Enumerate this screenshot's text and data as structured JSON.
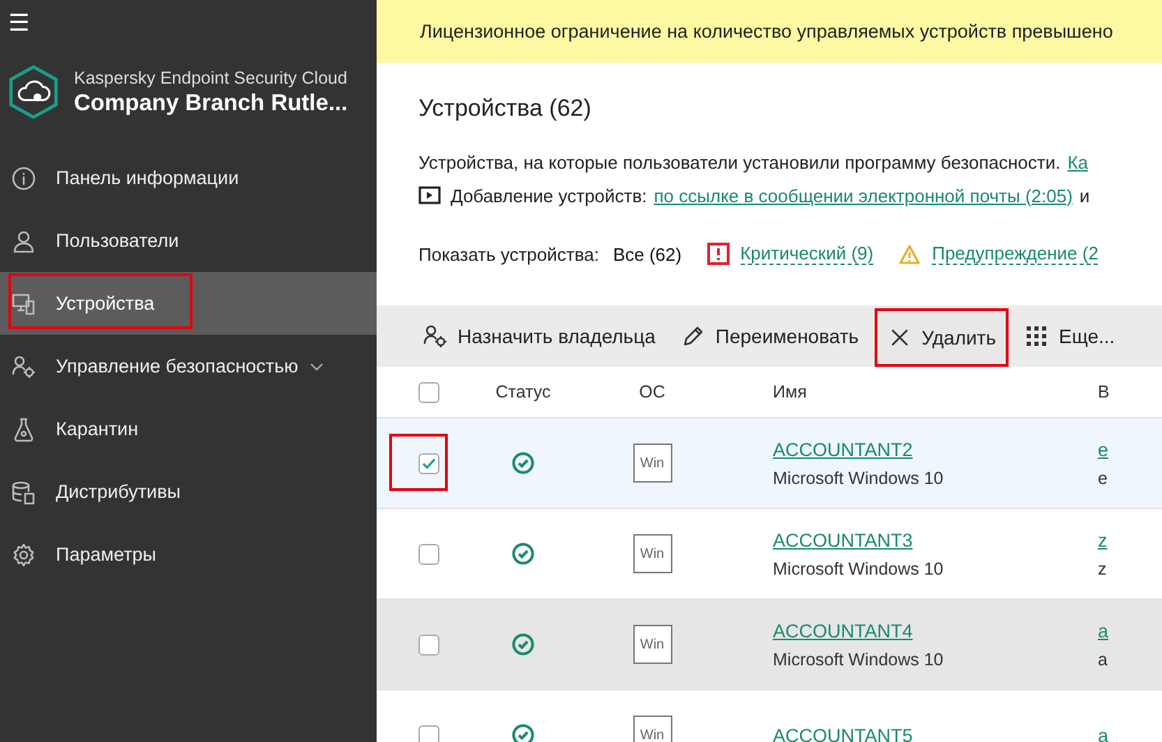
{
  "sidebar": {
    "menu_icon": "☰",
    "app_name": "Kaspersky Endpoint Security Cloud",
    "company": "Company Branch Rutle...",
    "items": [
      {
        "label": "Панель информации",
        "kind": "info",
        "selected": false,
        "highlighted": false,
        "expandable": false
      },
      {
        "label": "Пользователи",
        "kind": "user",
        "selected": false,
        "highlighted": false,
        "expandable": false
      },
      {
        "label": "Устройства",
        "kind": "devices",
        "selected": true,
        "highlighted": true,
        "expandable": false
      },
      {
        "label": "Управление безопасностью",
        "kind": "security",
        "selected": false,
        "highlighted": false,
        "expandable": true
      },
      {
        "label": "Карантин",
        "kind": "quarantine",
        "selected": false,
        "highlighted": false,
        "expandable": false
      },
      {
        "label": "Дистрибутивы",
        "kind": "packages",
        "selected": false,
        "highlighted": false,
        "expandable": false
      },
      {
        "label": "Параметры",
        "kind": "settings",
        "selected": false,
        "highlighted": false,
        "expandable": false
      }
    ]
  },
  "banner": {
    "text": "Лицензионное ограничение на количество управляемых устройств превышено"
  },
  "page": {
    "title": "Устройства (62)",
    "description": "Устройства, на которые пользователи установили программу безопасности.",
    "description_link": "Ка",
    "video_label": "Добавление устройств:",
    "video_link": "по ссылке в сообщении электронной почты (2:05)",
    "video_tail": "и"
  },
  "filter": {
    "label": "Показать устройства:",
    "options": [
      {
        "label": "Все (62)",
        "kind": "all",
        "selected": true
      },
      {
        "label": "Критический (9)",
        "kind": "critical",
        "selected": false
      },
      {
        "label": "Предупреждение (2",
        "kind": "warning",
        "selected": false
      }
    ]
  },
  "toolbar": [
    {
      "label": "Назначить владельца",
      "kind": "owner",
      "highlighted": false
    },
    {
      "label": "Переименовать",
      "kind": "rename",
      "highlighted": false
    },
    {
      "label": "Удалить",
      "kind": "delete",
      "highlighted": true
    },
    {
      "label": "Еще...",
      "kind": "more",
      "highlighted": false
    }
  ],
  "table": {
    "select_all": {
      "checked": false
    },
    "columns": [
      {
        "label": "Статус"
      },
      {
        "label": "ОС"
      },
      {
        "label": "Имя"
      },
      {
        "label": "В"
      }
    ],
    "rows": [
      {
        "selected": true,
        "highlighted": true,
        "hovered": false,
        "kind": "ok",
        "os": "Win",
        "name": "ACCOUNTANT2",
        "os_name": "Microsoft Windows 10",
        "column_5": "e",
        "column_5_sub": "e"
      },
      {
        "selected": false,
        "highlighted": false,
        "hovered": false,
        "kind": "ok",
        "os": "Win",
        "name": "ACCOUNTANT3",
        "os_name": "Microsoft Windows 10",
        "column_5": "z",
        "column_5_sub": "z"
      },
      {
        "selected": false,
        "highlighted": false,
        "hovered": true,
        "kind": "ok",
        "os": "Win",
        "name": "ACCOUNTANT4",
        "os_name": "Microsoft Windows 10",
        "column_5": "a",
        "column_5_sub": "a"
      },
      {
        "selected": false,
        "highlighted": false,
        "hovered": false,
        "kind": "ok",
        "os": "Win",
        "name": "ACCOUNTANT5",
        "column_5": "a"
      }
    ]
  }
}
